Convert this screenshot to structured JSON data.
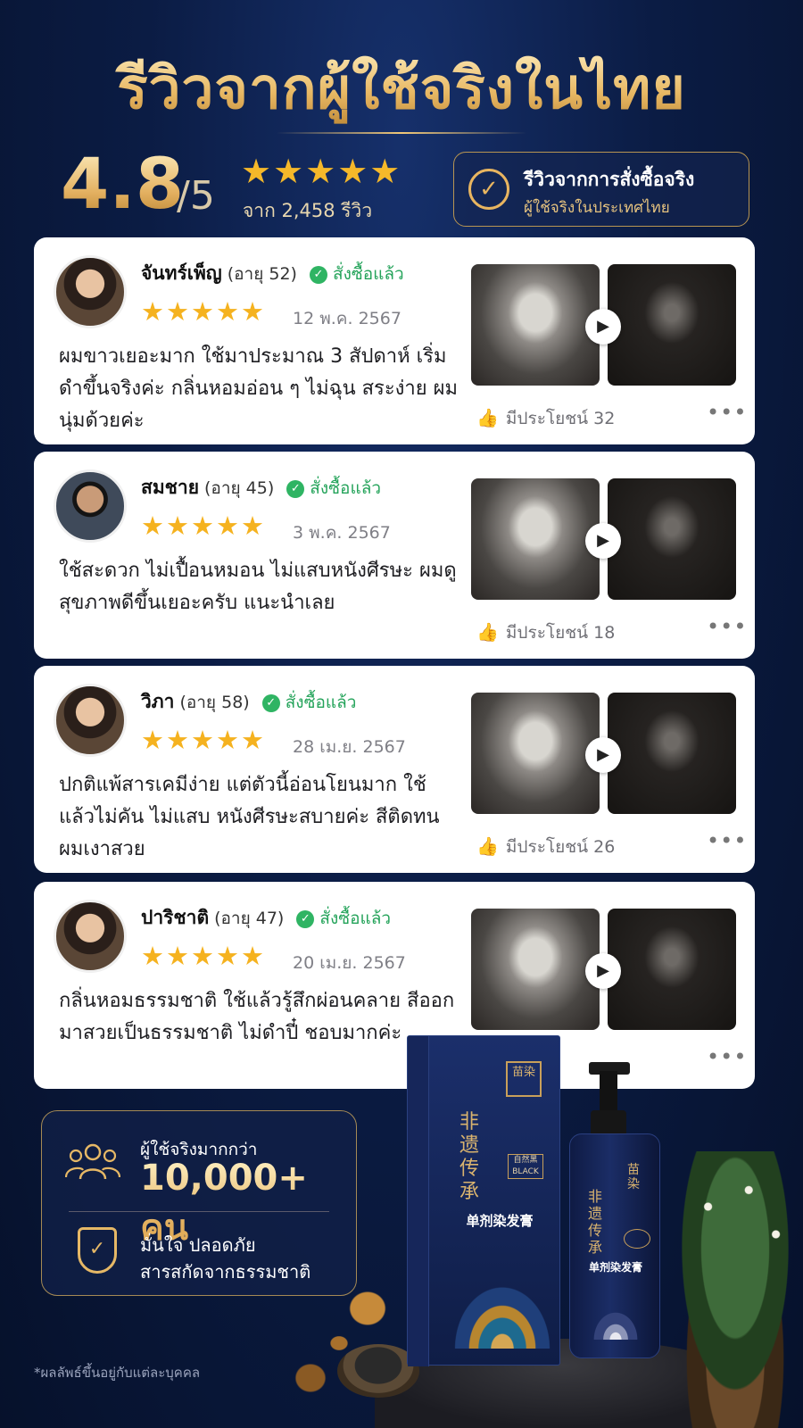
{
  "header": {
    "title": "รีวิวจากผู้ใช้จริงในไทย",
    "rating": "4.8",
    "rating_max": "/5",
    "stars": "★★★★★",
    "review_count": "จาก 2,458 รีวิว",
    "verify_title": "รีวิวจากการสั่งซื้อจริง",
    "verify_sub": "ผู้ใช้จริงในประเทศไทย",
    "verify_icon": "✓"
  },
  "reviews": [
    {
      "name": "จันทร์เพ็ญ",
      "age": "(อายุ 52)",
      "bought": "สั่งซื้อแล้ว",
      "stars": "★★★★★",
      "date": "12 พ.ค. 2567",
      "text": "ผมขาวเยอะมาก ใช้มาประมาณ 3 สัปดาห์ เริ่มดำขึ้นจริงค่ะ กลิ่นหอมอ่อน ๆ ไม่ฉุน สระง่าย ผมนุ่มด้วยค่ะ",
      "helpful": "มีประโยชน์ 32"
    },
    {
      "name": "สมชาย",
      "age": "(อายุ 45)",
      "bought": "สั่งซื้อแล้ว",
      "stars": "★★★★★",
      "date": "3 พ.ค. 2567",
      "text": "ใช้สะดวก ไม่เปื้อนหมอน ไม่แสบหนังศีรษะ ผมดูสุขภาพดีขึ้นเยอะครับ แนะนำเลย",
      "helpful": "มีประโยชน์ 18"
    },
    {
      "name": "วิภา",
      "age": "(อายุ 58)",
      "bought": "สั่งซื้อแล้ว",
      "stars": "★★★★★",
      "date": "28 เม.ย. 2567",
      "text": "ปกติแพ้สารเคมีง่าย แต่ตัวนี้อ่อนโยนมาก ใช้แล้วไม่คัน ไม่แสบ หนังศีรษะสบายค่ะ สีติดทน ผมเงาสวย",
      "helpful": "มีประโยชน์ 26"
    },
    {
      "name": "ปาริชาติ",
      "age": "(อายุ 47)",
      "bought": "สั่งซื้อแล้ว",
      "stars": "★★★★★",
      "date": "20 เม.ย. 2567",
      "text": "กลิ่นหอมธรรมชาติ ใช้แล้วรู้สึกผ่อนคลาย สีออกมาสวยเป็นธรรมชาติ ไม่ดำปี๋ ชอบมากค่ะ",
      "helpful": ""
    }
  ],
  "icons": {
    "check": "✓",
    "play": "▶",
    "thumb": "👍",
    "more": "•••"
  },
  "stats": {
    "users_label": "ผู้ใช้จริงมากกว่า",
    "users_value": "10,000+ คน",
    "safe_line1": "มั่นใจ ปลอดภัย",
    "safe_line2": "สารสกัดจากธรรมชาติ"
  },
  "product": {
    "box_logo": "苗染",
    "box_cjk": "非遗传承",
    "box_black": "自然黑 BLACK",
    "box_name": "单剂染发膏",
    "bottle_logo": "苗染",
    "bottle_cjk": "非遗传承",
    "bottle_name": "单剂染发膏"
  },
  "disclaimer": "*ผลลัพธ์ขึ้นอยู่กับแต่ละบุคคล",
  "colors": {
    "gold": "#e8b560",
    "star": "#f5b21f",
    "verified_green": "#24a35a",
    "navy_bg": "#0b1c44"
  }
}
